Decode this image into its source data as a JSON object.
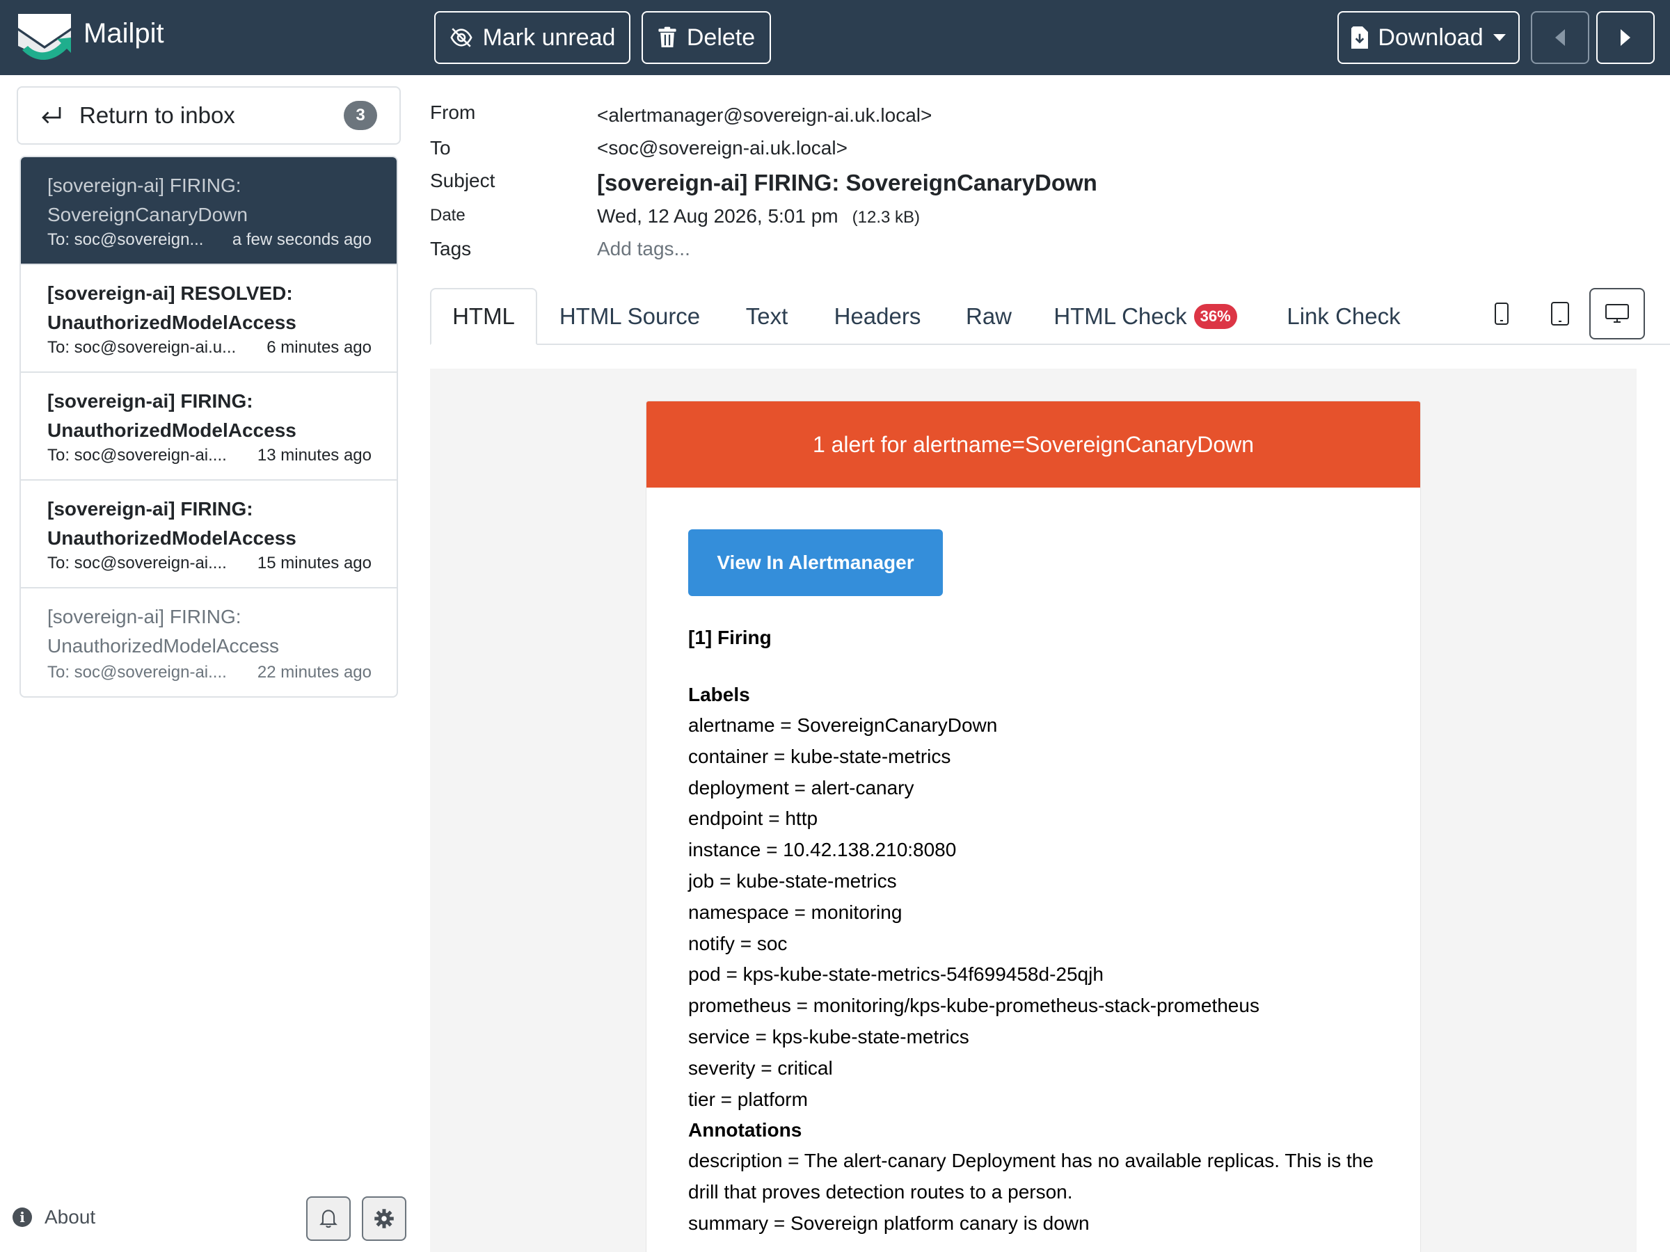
{
  "app": {
    "brand": "Mailpit",
    "colors": {
      "topbar": "#2c3e50",
      "alert": "#e6522c",
      "button": "#348eda",
      "badge": "#dc3545"
    }
  },
  "toolbar": {
    "mark_unread": "Mark unread",
    "delete": "Delete",
    "download": "Download",
    "icons": [
      "eye-slash-icon",
      "trash-icon",
      "download-icon",
      "chevron-left-icon",
      "chevron-right-icon"
    ]
  },
  "sidebar": {
    "return_label": "Return to inbox",
    "unread_count": "3",
    "messages": [
      {
        "subject": "[sovereign-ai] FIRING: SovereignCanaryDown",
        "to": "To: soc@sovereign...",
        "time": "a few seconds ago",
        "state": "active"
      },
      {
        "subject": "[sovereign-ai] RESOLVED: UnauthorizedModelAccess",
        "to": "To: soc@sovereign-ai.u...",
        "time": "6 minutes ago",
        "state": "unread"
      },
      {
        "subject": "[sovereign-ai] FIRING: UnauthorizedModelAccess",
        "to": "To: soc@sovereign-ai....",
        "time": "13 minutes ago",
        "state": "unread"
      },
      {
        "subject": "[sovereign-ai] FIRING: UnauthorizedModelAccess",
        "to": "To: soc@sovereign-ai....",
        "time": "15 minutes ago",
        "state": "unread"
      },
      {
        "subject": "[sovereign-ai] FIRING: UnauthorizedModelAccess",
        "to": "To: soc@sovereign-ai....",
        "time": "22 minutes ago",
        "state": "read"
      }
    ],
    "about": "About"
  },
  "headers": {
    "from_label": "From",
    "from": "<alertmanager@sovereign-ai.uk.local>",
    "to_label": "To",
    "to": "<soc@sovereign-ai.uk.local>",
    "subject_label": "Subject",
    "subject": "[sovereign-ai] FIRING: SovereignCanaryDown",
    "date_label": "Date",
    "date": "Wed, 12 Aug 2026, 5:01 pm",
    "size": "(12.3 kB)",
    "tags_label": "Tags",
    "tags_placeholder": "Add tags..."
  },
  "tabs": {
    "html": "HTML",
    "html_source": "HTML Source",
    "text": "Text",
    "headers": "Headers",
    "raw": "Raw",
    "html_check": "HTML Check",
    "html_check_score": "36%",
    "link_check": "Link Check"
  },
  "email": {
    "banner": "1 alert for alertname=SovereignCanaryDown",
    "button": "View In Alertmanager",
    "firing": "[1] Firing",
    "labels_heading": "Labels",
    "labels": [
      "alertname = SovereignCanaryDown",
      "container = kube-state-metrics",
      "deployment = alert-canary",
      "endpoint = http",
      "instance = 10.42.138.210:8080",
      "job = kube-state-metrics",
      "namespace = monitoring",
      "notify = soc",
      "pod = kps-kube-state-metrics-54f699458d-25qjh",
      "prometheus = monitoring/kps-kube-prometheus-stack-prometheus",
      "service = kps-kube-state-metrics",
      "severity = critical",
      "tier = platform"
    ],
    "annotations_heading": "Annotations",
    "annotations": [
      "description = The alert-canary Deployment has no available replicas. This is the",
      "drill that proves detection routes to a person.",
      "summary = Sovereign platform canary is down"
    ]
  }
}
